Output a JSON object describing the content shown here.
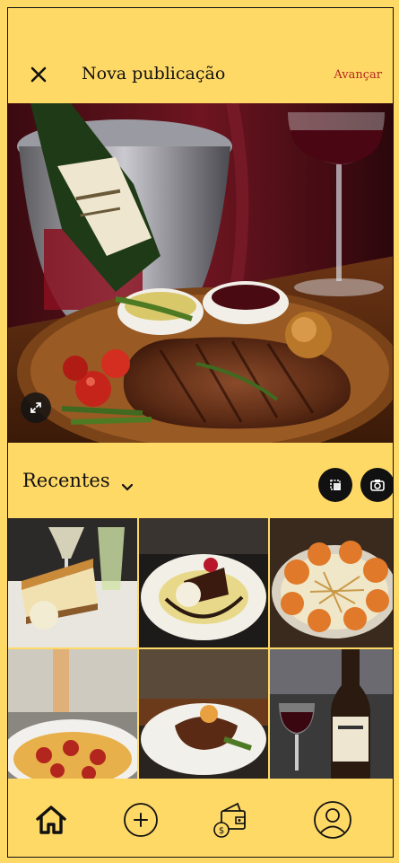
{
  "header": {
    "title": "Nova publicação",
    "next_label": "Avançar",
    "close_icon": "close-icon"
  },
  "gallery": {
    "section_label": "Recentes",
    "dropdown_icon": "chevron-down-icon",
    "multi_select_icon": "multi-select-icon",
    "camera_icon": "camera-icon"
  },
  "nav": {
    "items": [
      {
        "icon": "home-icon"
      },
      {
        "icon": "add-icon"
      },
      {
        "icon": "wallet-icon"
      },
      {
        "icon": "profile-icon"
      }
    ]
  },
  "colors": {
    "background": "#ffd966",
    "accent": "#b3261e",
    "text": "#111111"
  }
}
